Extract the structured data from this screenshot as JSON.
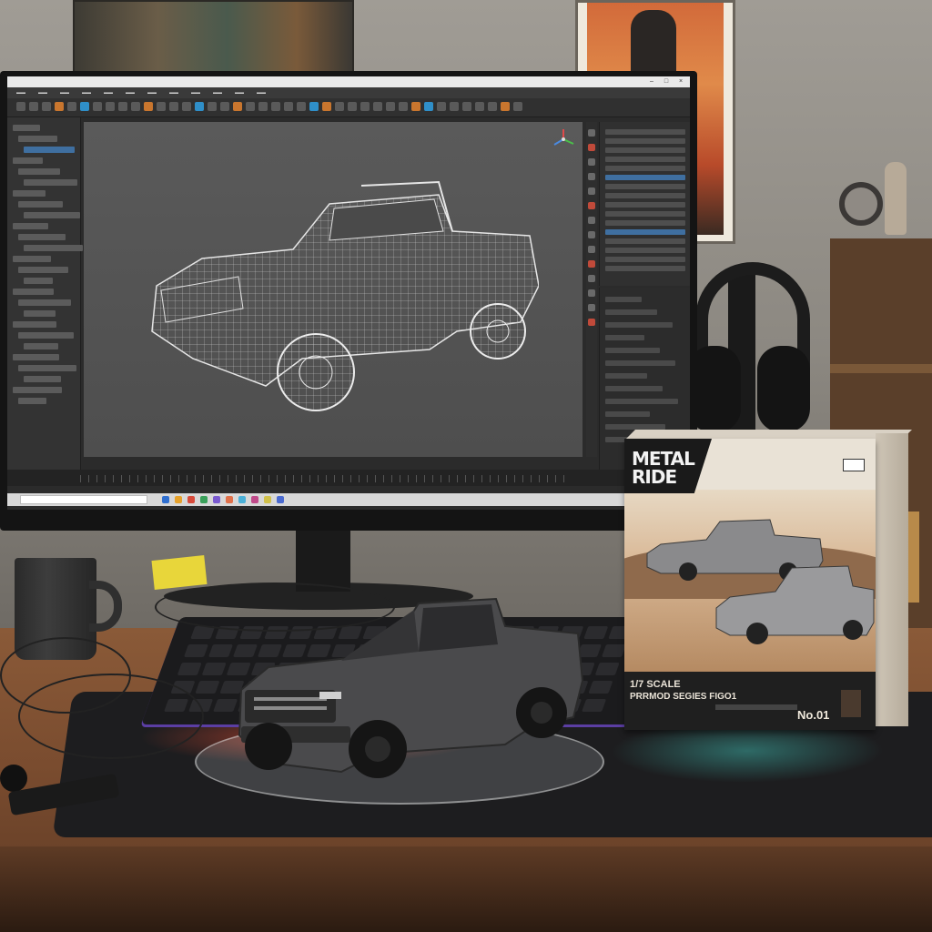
{
  "box": {
    "brand_line1": "METAL",
    "brand_line2": "RIDE",
    "scale": "1/7 SCALE",
    "series": "PRRMOD SEGIES FIGO1",
    "number": "No.01"
  },
  "colors": {
    "viewport": "#555555",
    "wireframe": "#d9d9d9",
    "truck_body": "#4a4a4c",
    "box_panel": "#1f1f1f",
    "desk": "#7a4c2f"
  }
}
